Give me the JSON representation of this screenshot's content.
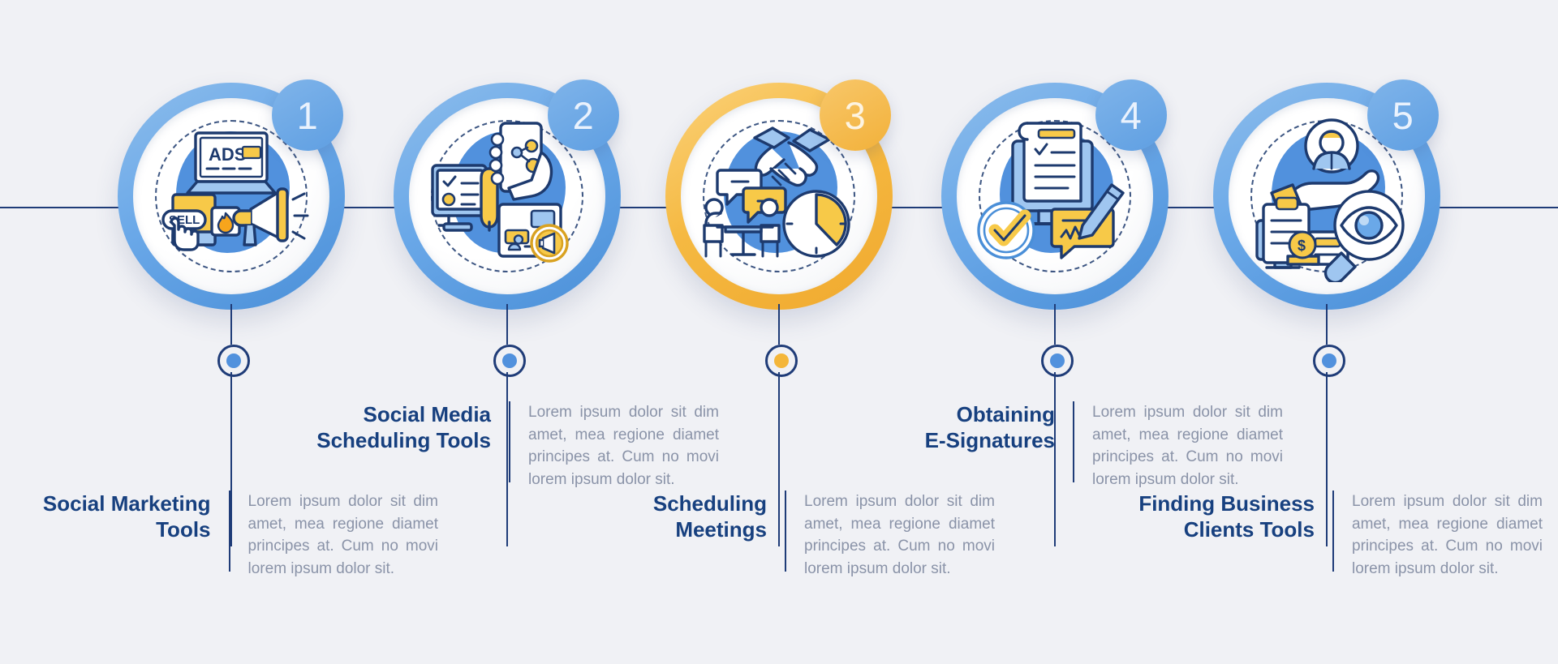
{
  "theme": {
    "background": "#f0f1f5",
    "line": "#1f3c78",
    "title_color": "#17407f",
    "body_color": "#8a93a8",
    "blue": "#6aa8e8",
    "blue_dark": "#4a8fd8",
    "orange": "#f5b942",
    "orange_dark": "#f0a92e",
    "dot_blue": "#5191dd",
    "dot_orange": "#f4b63a",
    "icon_yellow": "#f7c948",
    "icon_blue": "#9fc6f0"
  },
  "steps": [
    {
      "number": "1",
      "title": "Social Marketing\nTools",
      "body": "Lorem ipsum dolor sit dim amet, mea regione diamet principes at. Cum no movi lorem  ipsum  dolor  sit.",
      "accent": "blue",
      "icon_name": "social-marketing-ads-megaphone-icon",
      "icon_labels": [
        "ADS",
        "SELL"
      ]
    },
    {
      "number": "2",
      "title": "Social Media\nScheduling Tools",
      "body": "Lorem ipsum dolor sit dim amet, mea regione diamet principes at. Cum no movi lorem  ipsum  dolor  sit.",
      "accent": "blue",
      "icon_name": "scheduling-phone-checklist-icon",
      "icon_labels": []
    },
    {
      "number": "3",
      "title": "Scheduling\nMeetings",
      "body": "Lorem ipsum dolor sit dim amet, mea regione diamet principes at. Cum no movi lorem  ipsum  dolor  sit.",
      "accent": "orange",
      "icon_name": "meeting-handshake-clock-icon",
      "icon_labels": []
    },
    {
      "number": "4",
      "title": "Obtaining\nE-Signatures",
      "body": "Lorem ipsum dolor sit dim amet, mea regione diamet principes at. Cum no movi lorem  ipsum  dolor  sit.",
      "accent": "blue",
      "icon_name": "esignature-document-check-icon",
      "icon_labels": []
    },
    {
      "number": "5",
      "title": "Finding Business\nClients Tools",
      "body": "Lorem ipsum dolor sit dim amet, mea regione diamet principes at. Cum no movi lorem  ipsum  dolor  sit.",
      "accent": "blue",
      "icon_name": "finding-clients-magnifier-hand-icon",
      "icon_labels": [
        "$"
      ]
    }
  ]
}
